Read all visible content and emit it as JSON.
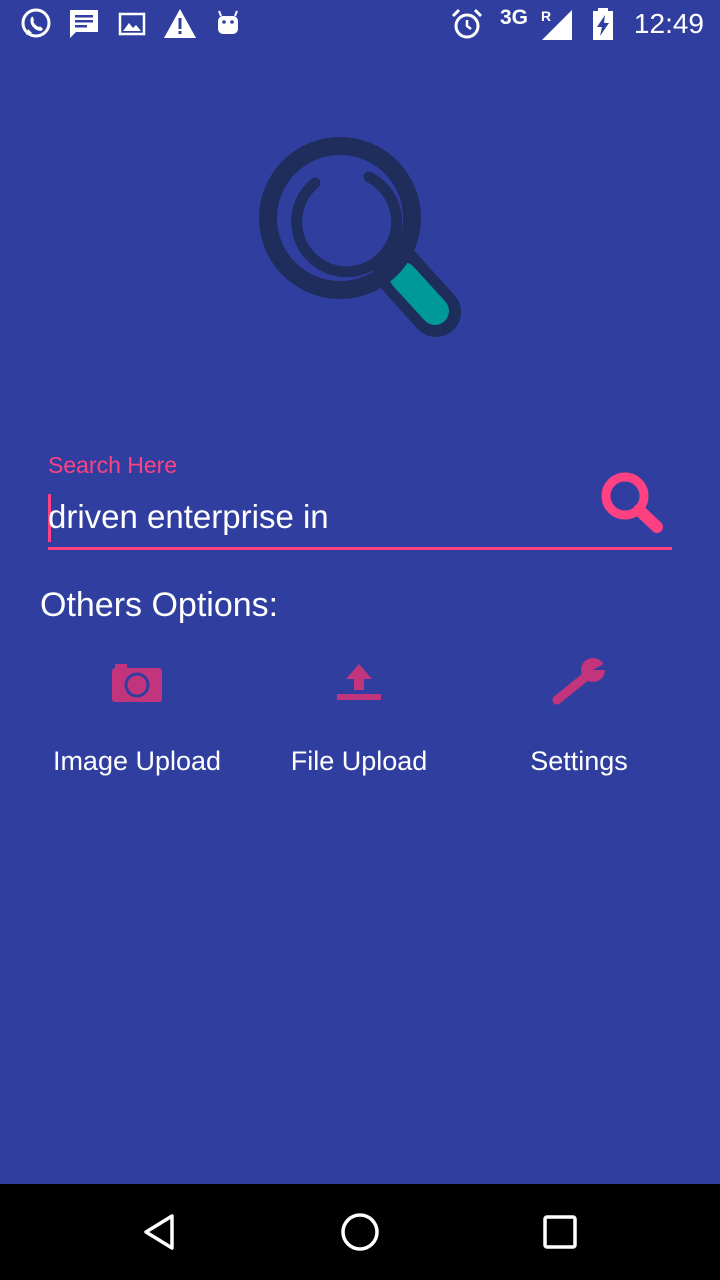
{
  "status_bar": {
    "network": "3G",
    "roaming": "R",
    "time": "12:49",
    "left_icons": [
      "whatsapp-icon",
      "message-icon",
      "image-icon",
      "warning-icon",
      "android-icon"
    ],
    "right_icons": [
      "alarm-icon",
      "signal-icon",
      "battery-charging-icon"
    ]
  },
  "search": {
    "label": "Search Here",
    "value": "driven enterprise in",
    "submit_icon": "search-icon"
  },
  "others": {
    "heading": "Others Options:",
    "options": [
      {
        "label": "Image Upload",
        "icon": "camera-icon"
      },
      {
        "label": "File Upload",
        "icon": "upload-icon"
      },
      {
        "label": "Settings",
        "icon": "wrench-icon"
      }
    ]
  },
  "navigation": {
    "buttons": [
      "back-icon",
      "home-icon",
      "recents-icon"
    ]
  },
  "colors": {
    "background": "#303f9f",
    "accent": "#ff4081",
    "option_icon": "#c2357c",
    "logo_ring": "#1f2d5c",
    "logo_handle": "#009999",
    "nav_bar": "#000000"
  }
}
